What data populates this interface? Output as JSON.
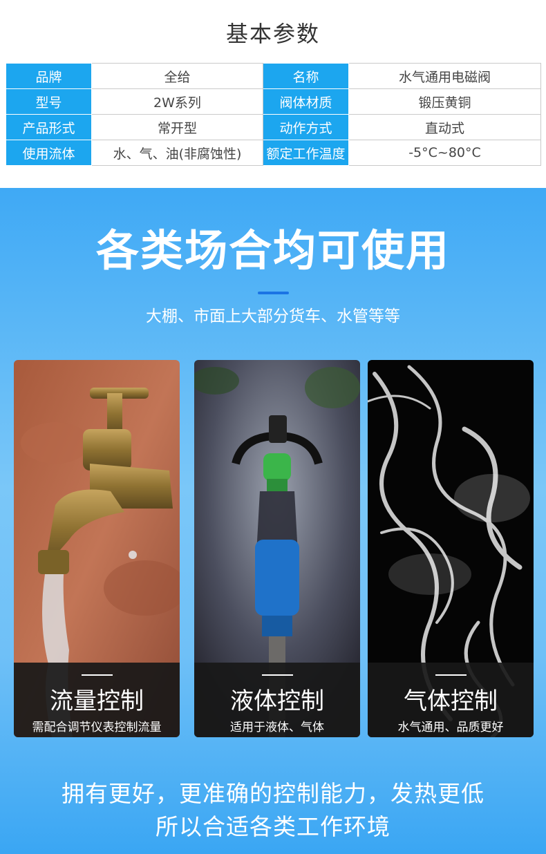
{
  "params": {
    "title": "基本参数",
    "rows": [
      [
        "品牌",
        "全给",
        "名称",
        "水气通用电磁阀"
      ],
      [
        "型号",
        "2W系列",
        "阀体材质",
        "锻压黄铜"
      ],
      [
        "产品形式",
        "常开型",
        "动作方式",
        "直动式"
      ],
      [
        "使用流体",
        "水、气、油(非腐蚀性)",
        "额定工作温度",
        "-5°C~80°C"
      ]
    ]
  },
  "usage": {
    "title": "各类场合均可使用",
    "subtitle": "大棚、市面上大部分货车、水管等等"
  },
  "cards": [
    {
      "title": "流量控制",
      "desc": "需配合调节仪表控制流量",
      "photo": "brass-faucet-water"
    },
    {
      "title": "液体控制",
      "desc": "适用于液体、气体",
      "photo": "sprinkler-mist"
    },
    {
      "title": "气体控制",
      "desc": "水气通用、品质更好",
      "photo": "white-smoke"
    }
  ],
  "bottom": {
    "line1": "拥有更好，更准确的控制能力，发热更低",
    "line2": "所以合适各类工作环境"
  },
  "colors": {
    "key_cell": "#1ca6ef",
    "accent_line": "#1b74e4",
    "card_overlay": "#181818"
  }
}
